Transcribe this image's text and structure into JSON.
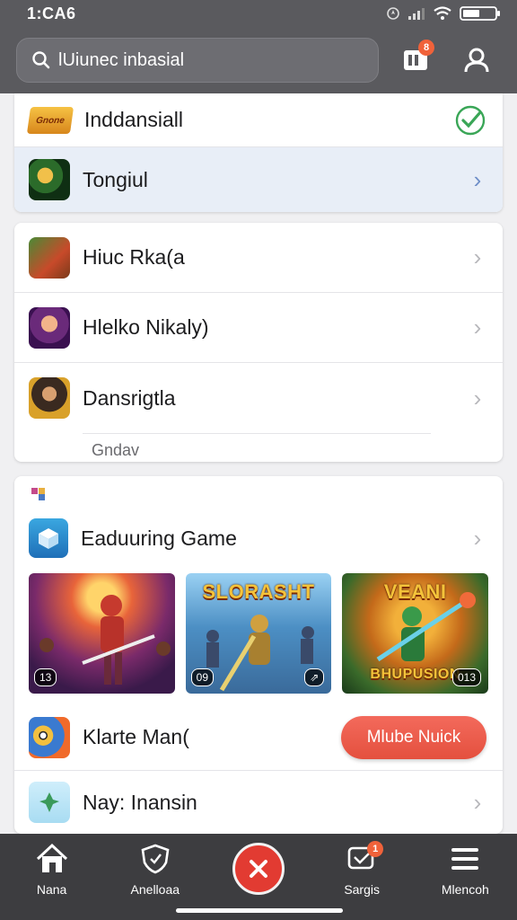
{
  "status": {
    "time": "1:CA6"
  },
  "search": {
    "placeholder": "lUiunec inbasial"
  },
  "header": {
    "notifications_badge": "8"
  },
  "top_card": [
    {
      "label": "Inddansiall",
      "icon": "check-icon"
    },
    {
      "label": "Tongiul",
      "icon": "chevron-right-icon"
    }
  ],
  "top_card_logo": "Gnone",
  "list_card": {
    "items": [
      {
        "label": "Hiuc Rka(a"
      },
      {
        "label": "Hlelko Nikaly)"
      },
      {
        "label": "Dansrigtla"
      }
    ],
    "footer": "Gndav"
  },
  "games_card": {
    "header": {
      "label": "Eaduuring Game"
    },
    "tiles": [
      {
        "title": "",
        "count": "13"
      },
      {
        "title": "SLORASHT",
        "count": "09",
        "count2": ""
      },
      {
        "title": "VEANI",
        "subtitle": "BHUPUSION",
        "count": "013"
      }
    ],
    "featured": {
      "label": "Klarte Man(",
      "button": "Mlube Nuick"
    },
    "last": {
      "label": "Nay: Inansin"
    }
  },
  "bottom_nav": [
    {
      "label": "Nana",
      "icon": "home-icon"
    },
    {
      "label": "Anelloaa",
      "icon": "shield-icon"
    },
    {
      "label": "",
      "icon": "close-icon"
    },
    {
      "label": "Sargis",
      "icon": "chat-icon",
      "badge": "1"
    },
    {
      "label": "Mlencoh",
      "icon": "menu-icon"
    }
  ],
  "colors": {
    "accent": "#e23b32",
    "check": "#3aa657",
    "button": "#e4503e"
  }
}
